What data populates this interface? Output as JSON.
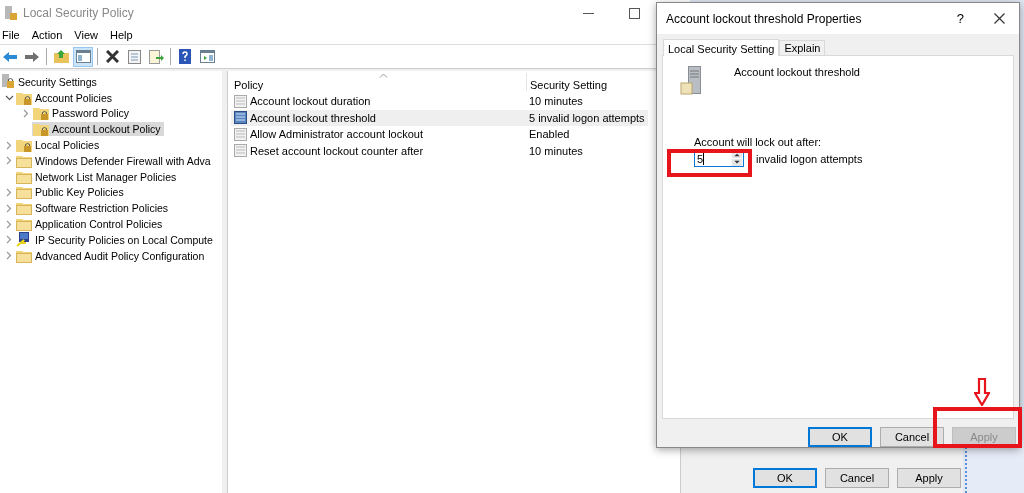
{
  "main_window": {
    "title": "Local Security Policy",
    "menu": [
      "File",
      "Action",
      "View",
      "Help"
    ]
  },
  "toolbar": [
    {
      "kind": "back",
      "pressed": false
    },
    {
      "kind": "forward",
      "pressed": false
    },
    {
      "kind": "up",
      "pressed": false
    },
    {
      "kind": "tree",
      "pressed": true
    },
    {
      "kind": "delete",
      "pressed": false
    },
    {
      "kind": "properties",
      "pressed": false
    },
    {
      "kind": "export",
      "pressed": false
    },
    {
      "kind": "help",
      "pressed": false
    },
    {
      "kind": "console",
      "pressed": false
    }
  ],
  "tree": [
    {
      "label": "Security Settings",
      "kind": "root",
      "selected": false,
      "children": [
        {
          "label": "Account Policies",
          "kind": "secured",
          "expanded": true,
          "selected": false,
          "children": [
            {
              "label": "Password Policy",
              "kind": "secured",
              "expanded": false,
              "selected": false
            },
            {
              "label": "Account Lockout Policy",
              "kind": "secured",
              "selected": true
            }
          ]
        },
        {
          "label": "Local Policies",
          "kind": "secured",
          "expanded": false,
          "selected": false
        },
        {
          "label": "Windows Defender Firewall with Adva",
          "kind": "folder",
          "expanded": false,
          "selected": false
        },
        {
          "label": "Network List Manager Policies",
          "kind": "folder",
          "selected": false
        },
        {
          "label": "Public Key Policies",
          "kind": "folder",
          "expanded": false,
          "selected": false
        },
        {
          "label": "Software Restriction Policies",
          "kind": "folder",
          "expanded": false,
          "selected": false
        },
        {
          "label": "Application Control Policies",
          "kind": "folder",
          "expanded": false,
          "selected": false
        },
        {
          "label": "IP Security Policies on Local Compute",
          "kind": "network",
          "expanded": false,
          "selected": false
        },
        {
          "label": "Advanced Audit Policy Configuration",
          "kind": "folder",
          "expanded": false,
          "selected": false
        }
      ]
    }
  ],
  "table": {
    "columns": [
      "Policy",
      "Security Setting"
    ],
    "rows": [
      {
        "policy": "Account lockout duration",
        "setting": "10 minutes",
        "selected": false
      },
      {
        "policy": "Account lockout threshold",
        "setting": "5 invalid logon attempts",
        "selected": true
      },
      {
        "policy": "Allow Administrator account lockout",
        "setting": "Enabled",
        "selected": false
      },
      {
        "policy": "Reset account lockout counter after",
        "setting": "10 minutes",
        "selected": false
      }
    ]
  },
  "dialog": {
    "title": "Account lockout threshold Properties",
    "help": "?",
    "tabs": [
      {
        "label": "Local Security Setting",
        "selected": true
      },
      {
        "label": "Explain",
        "selected": false
      }
    ],
    "policy_name": "Account lockout threshold",
    "field_label": "Account will lock out after:",
    "value": "5",
    "suffix": "invalid logon attempts",
    "buttons": [
      {
        "label": "OK",
        "default": true,
        "disabled": false
      },
      {
        "label": "Cancel",
        "default": false,
        "disabled": false
      },
      {
        "label": "Apply",
        "default": false,
        "disabled": true
      }
    ]
  },
  "background_window": {
    "buttons": [
      {
        "label": "OK",
        "default": true,
        "disabled": false
      },
      {
        "label": "Cancel",
        "default": false,
        "disabled": false
      },
      {
        "label": "Apply",
        "default": false,
        "disabled": false
      }
    ]
  }
}
